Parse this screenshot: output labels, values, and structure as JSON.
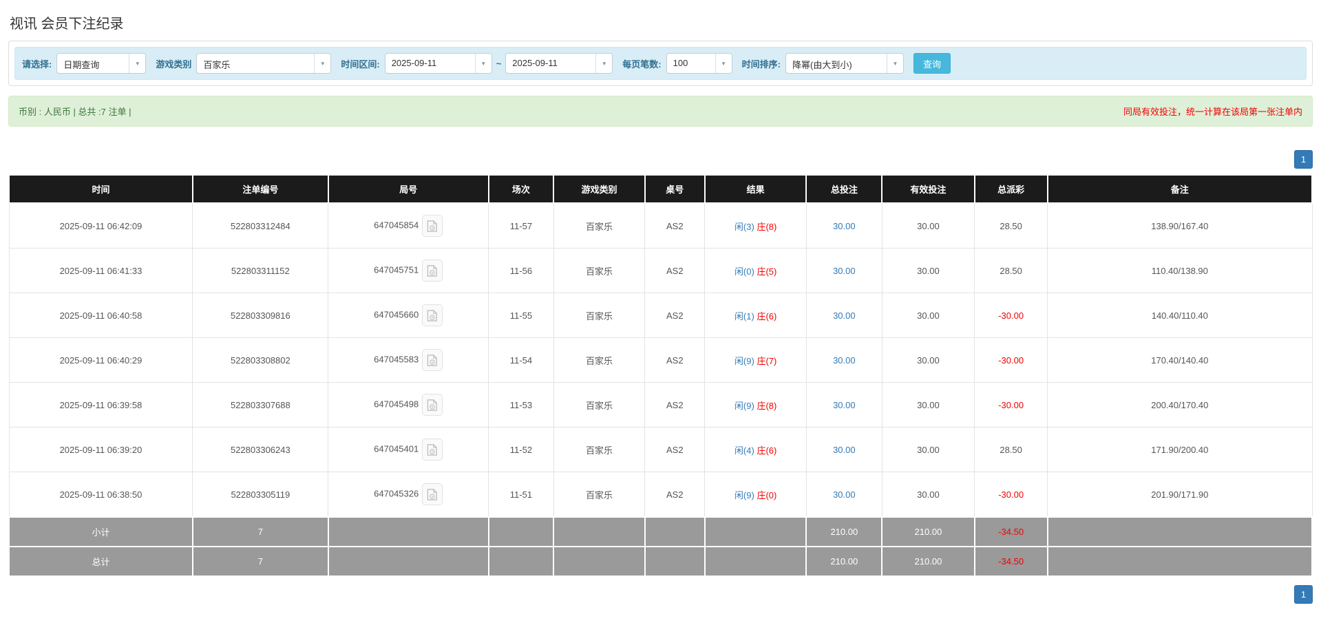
{
  "page": {
    "title": "视讯 会员下注纪录"
  },
  "colors": {
    "accent_blue": "#337ab7",
    "button_blue": "#47b8dc",
    "filter_bg": "#d9edf7",
    "filter_label": "#31708f",
    "summary_bg": "#dff0d8",
    "negative_red": "#f20000",
    "player_blue": "#337ab7",
    "banker_red": "#f20000",
    "table_header_bg": "#1b1b1b",
    "totals_row_bg": "#9a9a9a"
  },
  "filters": {
    "select_label": "请选择:",
    "select_value": "日期查询",
    "game_label": "游戏类别",
    "game_value": "百家乐",
    "range_label": "时间区间:",
    "range_from": "2025-09-11",
    "range_tilde": "~",
    "range_to": "2025-09-11",
    "page_size_label": "每页笔数:",
    "page_size_value": "100",
    "sort_label": "时间排序:",
    "sort_value": "降幂(由大到小)",
    "search_button": "查询",
    "dropdown_arrow_icon": "▼"
  },
  "summary": {
    "left": "币别 : 人民币 | 总共 :7 注单 |",
    "right": "同局有效投注，统一计算在该局第一张注单内"
  },
  "pagination": {
    "page": "1"
  },
  "table": {
    "headers": [
      "时间",
      "注单编号",
      "局号",
      "场次",
      "游戏类别",
      "桌号",
      "结果",
      "总投注",
      "有效投注",
      "总派彩",
      "备注"
    ],
    "rows": [
      {
        "time": "2025-09-11 06:42:09",
        "bet_id": "522803312484",
        "round": "647045854",
        "session": "11-57",
        "game": "百家乐",
        "table_no": "AS2",
        "result_player": "闲(3)",
        "result_banker": "庄(8)",
        "total_bet": "30.00",
        "valid_bet": "30.00",
        "payout": "28.50",
        "remark": "138.90/167.40"
      },
      {
        "time": "2025-09-11 06:41:33",
        "bet_id": "522803311152",
        "round": "647045751",
        "session": "11-56",
        "game": "百家乐",
        "table_no": "AS2",
        "result_player": "闲(0)",
        "result_banker": "庄(5)",
        "total_bet": "30.00",
        "valid_bet": "30.00",
        "payout": "28.50",
        "remark": "110.40/138.90"
      },
      {
        "time": "2025-09-11 06:40:58",
        "bet_id": "522803309816",
        "round": "647045660",
        "session": "11-55",
        "game": "百家乐",
        "table_no": "AS2",
        "result_player": "闲(1)",
        "result_banker": "庄(6)",
        "total_bet": "30.00",
        "valid_bet": "30.00",
        "payout": "-30.00",
        "remark": "140.40/110.40"
      },
      {
        "time": "2025-09-11 06:40:29",
        "bet_id": "522803308802",
        "round": "647045583",
        "session": "11-54",
        "game": "百家乐",
        "table_no": "AS2",
        "result_player": "闲(9)",
        "result_banker": "庄(7)",
        "total_bet": "30.00",
        "valid_bet": "30.00",
        "payout": "-30.00",
        "remark": "170.40/140.40"
      },
      {
        "time": "2025-09-11 06:39:58",
        "bet_id": "522803307688",
        "round": "647045498",
        "session": "11-53",
        "game": "百家乐",
        "table_no": "AS2",
        "result_player": "闲(9)",
        "result_banker": "庄(8)",
        "total_bet": "30.00",
        "valid_bet": "30.00",
        "payout": "-30.00",
        "remark": "200.40/170.40"
      },
      {
        "time": "2025-09-11 06:39:20",
        "bet_id": "522803306243",
        "round": "647045401",
        "session": "11-52",
        "game": "百家乐",
        "table_no": "AS2",
        "result_player": "闲(4)",
        "result_banker": "庄(6)",
        "total_bet": "30.00",
        "valid_bet": "30.00",
        "payout": "28.50",
        "remark": "171.90/200.40"
      },
      {
        "time": "2025-09-11 06:38:50",
        "bet_id": "522803305119",
        "round": "647045326",
        "session": "11-51",
        "game": "百家乐",
        "table_no": "AS2",
        "result_player": "闲(9)",
        "result_banker": "庄(0)",
        "total_bet": "30.00",
        "valid_bet": "30.00",
        "payout": "-30.00",
        "remark": "201.90/171.90"
      }
    ],
    "subtotal": {
      "label": "小计",
      "count": "7",
      "total_bet": "210.00",
      "valid_bet": "210.00",
      "payout": "-34.50"
    },
    "total": {
      "label": "总计",
      "count": "7",
      "total_bet": "210.00",
      "valid_bet": "210.00",
      "payout": "-34.50"
    }
  }
}
